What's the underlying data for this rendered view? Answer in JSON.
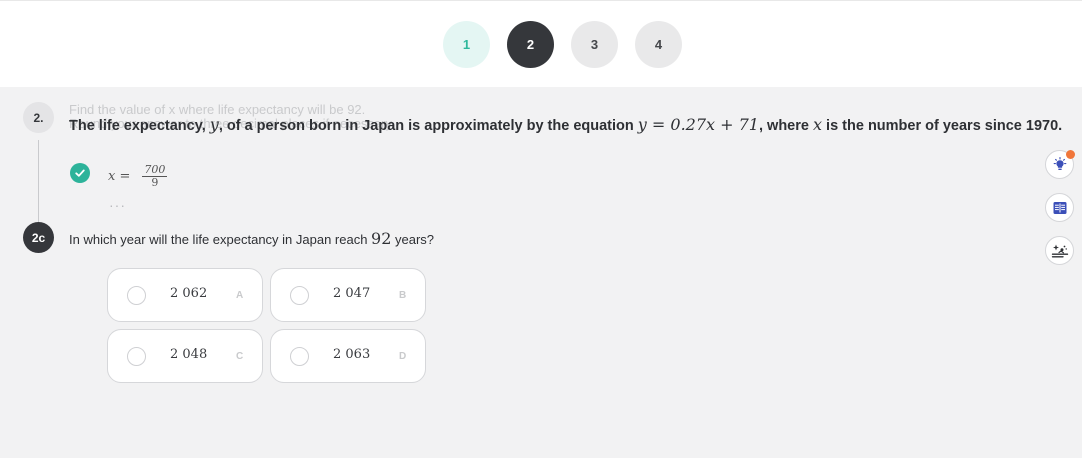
{
  "steps": [
    "1",
    "2",
    "3",
    "4"
  ],
  "current_step": "2",
  "colors": {
    "completed_step_bg": "#e4f6f3",
    "completed_step_text": "#2fb89c",
    "current_step_bg": "#35373b",
    "correct_green": "#2db39a",
    "notification_dot": "#f0763a",
    "tool_blue": "#3b4fb8"
  },
  "problem": {
    "badge": "2.",
    "faded_line_1": "Find the value of x where life expectancy will be 92.",
    "faded_line_2": "Round your answer to three decimal places if necessary.",
    "stem": {
      "p1": "The life expectancy, ",
      "var_y": "y",
      "p2": ", of a person born in Japan is approximately by the equation ",
      "equation": "y = 0.27x + 71",
      "p3": ", where ",
      "var_x": "x",
      "p4": " is the number of years since 1970."
    },
    "answer": {
      "status_icon": "check-icon",
      "var": "x =",
      "numerator": "700",
      "denominator": "9"
    },
    "more": "···"
  },
  "question": {
    "badge": "2c",
    "text_before": "In which year will the life expectancy in Japan reach ",
    "value": "92",
    "text_after": " years?",
    "choices": [
      {
        "value": "2 062",
        "letter": "A"
      },
      {
        "value": "2 047",
        "letter": "B"
      },
      {
        "value": "2 048",
        "letter": "C"
      },
      {
        "value": "2 063",
        "letter": "D"
      }
    ]
  },
  "tools": [
    {
      "icon": "lightbulb-hint-icon",
      "has_notification": true
    },
    {
      "icon": "reference-table-icon"
    },
    {
      "icon": "sparkle-explain-icon"
    }
  ]
}
